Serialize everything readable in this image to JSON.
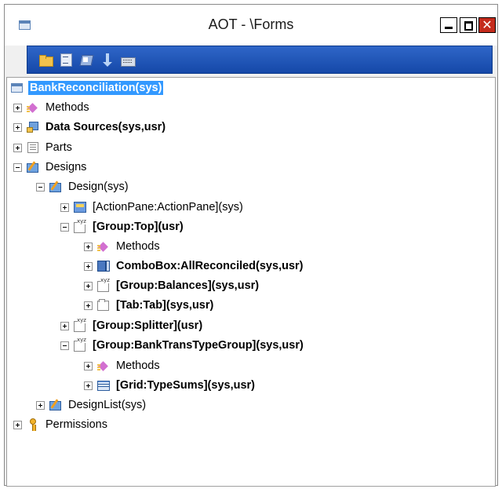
{
  "window": {
    "title": "AOT - \\Forms",
    "close_glyph": "✕"
  },
  "toolbar": {
    "buttons": [
      "open-icon",
      "properties-icon",
      "compile-icon",
      "sort-icon",
      "keyboard-icon"
    ]
  },
  "tree": {
    "root": "BankReconciliation(sys)",
    "methods": "Methods",
    "data_sources": "Data Sources(sys,usr)",
    "parts": "Parts",
    "designs": "Designs",
    "design": "Design(sys)",
    "action_pane": "[ActionPane:ActionPane](sys)",
    "group_top": "[Group:Top](usr)",
    "group_top_methods": "Methods",
    "combobox": "ComboBox:AllReconciled(sys,usr)",
    "group_balances": "[Group:Balances](sys,usr)",
    "tab": "[Tab:Tab](sys,usr)",
    "group_splitter": "[Group:Splitter](usr)",
    "group_banktranstype": "[Group:BankTransTypeGroup](sys,usr)",
    "group_banktranstype_methods": "Methods",
    "grid_typesums": "[Grid:TypeSums](sys,usr)",
    "design_list": "DesignList(sys)",
    "permissions": "Permissions"
  }
}
